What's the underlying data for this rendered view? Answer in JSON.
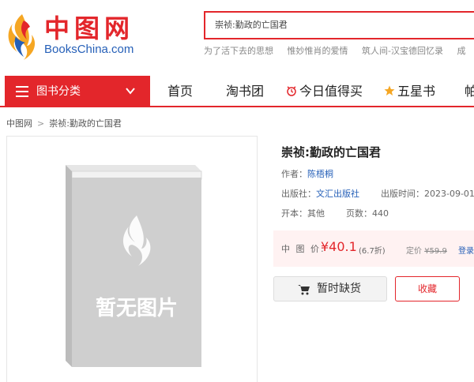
{
  "header": {
    "logo_cn": "中图网",
    "logo_en": "BooksChina.com",
    "search_value": "崇祯:勤政的亡国君",
    "hot_words": [
      "为了活下去的思想",
      "惟妙惟肖的爱情",
      "筑人间-汉宝德回忆录",
      "成"
    ]
  },
  "nav": {
    "category_label": "图书分类",
    "items": [
      "首页",
      "淘书团",
      "今日值得买",
      "五星书",
      "帕"
    ]
  },
  "breadcrumb": [
    "中图网",
    "崇祯:勤政的亡国君"
  ],
  "product": {
    "image_placeholder": "暂无图片",
    "title": "崇祯:勤政的亡国君",
    "author_label": "作者：",
    "author": "陈梧桐",
    "publisher_label": "出版社：",
    "publisher": "文汇出版社",
    "pubdate_label": "出版时间：",
    "pubdate": "2023-09-01",
    "format_label": "开本：",
    "format": "其他",
    "pages_label": "页数：",
    "pages": "440",
    "price_label": "中 图 价:",
    "price": "¥40.1",
    "discount": "(6.7折)",
    "list_price_label": "定价",
    "list_price": "¥59.9",
    "login_label": "登录",
    "out_of_stock_label": "暂时缺货",
    "favorite_label": "收藏"
  },
  "colors": {
    "brand_red": "#e3262b",
    "link_blue": "#2660b8"
  }
}
